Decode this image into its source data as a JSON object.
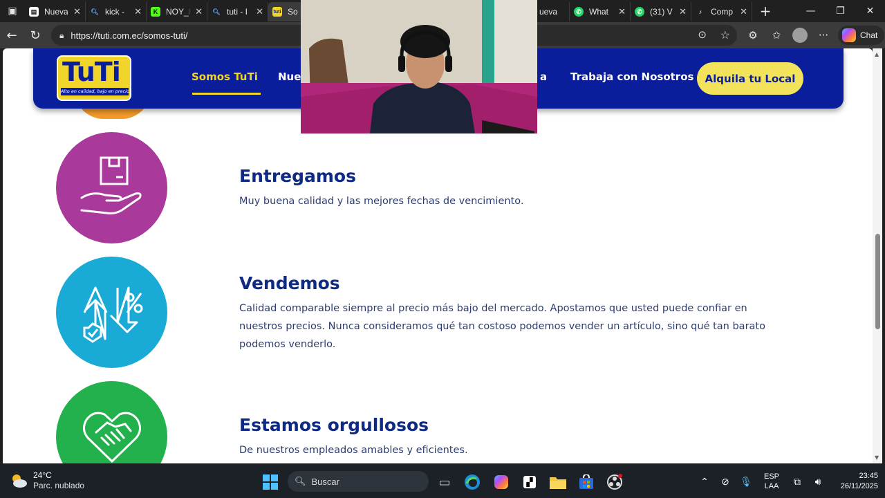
{
  "browser": {
    "tabs": [
      {
        "title": "Nueva",
        "fav_color": "#ffffff"
      },
      {
        "title": "kick -",
        "fav_color": "#60a5ff"
      },
      {
        "title": "NOY_I",
        "fav_color": "#53fc18"
      },
      {
        "title": "tuti - I",
        "fav_color": "#60a5ff"
      },
      {
        "title": "So",
        "fav_color": "#f2d52a"
      },
      {
        "title": "ueva",
        "fav_color": "#ffffff"
      },
      {
        "title": "What",
        "fav_color": "#25d366"
      },
      {
        "title": "(31) V",
        "fav_color": "#25d366"
      },
      {
        "title": "Comp",
        "fav_color": "#ffffff"
      }
    ],
    "url": "https://tuti.com.ec/somos-tuti/",
    "copilot_label": "Chat"
  },
  "site": {
    "logo_word": "TuTi",
    "logo_tagline": "Alto en calidad, bajo en precio.",
    "nav": {
      "somos": "Somos TuTi",
      "nues": "Nues",
      "a": "a",
      "trabaja": "Trabaja con Nosotros",
      "cta": "Alquila tu Local"
    },
    "items": [
      {
        "title": "Entregamos",
        "text": "Muy buena calidad y las mejores fechas de vencimiento.",
        "color": "#a9399a",
        "icon": "hand-box-icon"
      },
      {
        "title": "Vendemos",
        "text": "Calidad comparable siempre al precio más bajo del mercado. Apostamos que usted puede confiar en nuestros precios. Nunca consideramos qué tan costoso podemos vender un artículo, sino qué tan barato podemos venderlo.",
        "color": "#1aaad6",
        "icon": "price-arrows-icon"
      },
      {
        "title": "Estamos orgullosos",
        "text": "De nuestros empleados amables y eficientes.",
        "color": "#22b14c",
        "icon": "heart-handshake-icon"
      }
    ]
  },
  "taskbar": {
    "weather_temp": "24°C",
    "weather_cond": "Parc. nublado",
    "search_placeholder": "Buscar",
    "lang_1": "ESP",
    "lang_2": "LAA",
    "time": "23:45",
    "date": "26/11/2025"
  }
}
